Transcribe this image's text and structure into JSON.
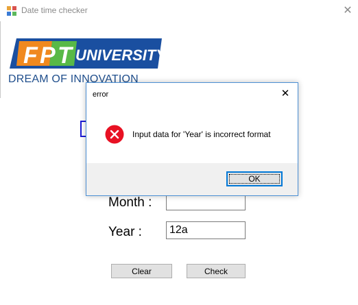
{
  "window": {
    "title": "Date time checker",
    "close_glyph": "✕"
  },
  "logo": {
    "brand_letters": [
      "F",
      "P",
      "T"
    ],
    "brand_word": "UNIVERSITY",
    "tagline": "DREAM OF INNOVATION",
    "colors": {
      "blue": "#1a4fa0",
      "orange": "#f0891f",
      "green": "#58b947"
    }
  },
  "form": {
    "month_label": "Month :",
    "month_value": "",
    "year_label": "Year :",
    "year_value": "12a",
    "clear_label": "Clear",
    "check_label": "Check"
  },
  "dialog": {
    "title": "error",
    "close_glyph": "✕",
    "message": "Input data for 'Year' is incorrect format",
    "ok_label": "OK",
    "icon": "error-icon",
    "icon_color": "#e81123"
  }
}
